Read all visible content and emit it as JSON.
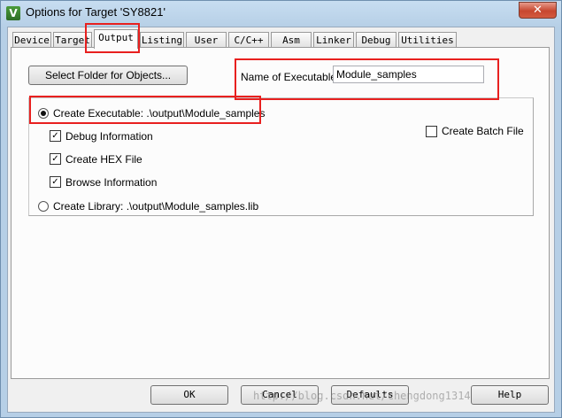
{
  "window": {
    "title": "Options for Target 'SY8821'",
    "icon": "V",
    "close_glyph": "✕"
  },
  "tabs": [
    "Device",
    "Target",
    "Output",
    "Listing",
    "User",
    "C/C++",
    "Asm",
    "Linker",
    "Debug",
    "Utilities"
  ],
  "active_tab": "Output",
  "output": {
    "select_folder_label": "Select Folder for Objects...",
    "name_of_executable_label": "Name of Executable:",
    "name_of_executable_value": "Module_samples",
    "create_executable_label": "Create Executable:  .\\output\\Module_samples",
    "create_executable_selected": true,
    "debug_info_label": "Debug Information",
    "debug_info_checked": true,
    "create_hex_label": "Create HEX File",
    "create_hex_checked": true,
    "browse_info_label": "Browse Information",
    "browse_info_checked": true,
    "create_library_label": "Create Library:  .\\output\\Module_samples.lib",
    "create_library_selected": false,
    "create_batch_label": "Create Batch File",
    "create_batch_checked": false
  },
  "buttons": {
    "ok": "OK",
    "cancel": "Cancel",
    "defaults": "Defaults",
    "help": "Help"
  },
  "watermark": "http://blog.csdn.net/chengdong1314",
  "highlight_color": "#e8201f"
}
